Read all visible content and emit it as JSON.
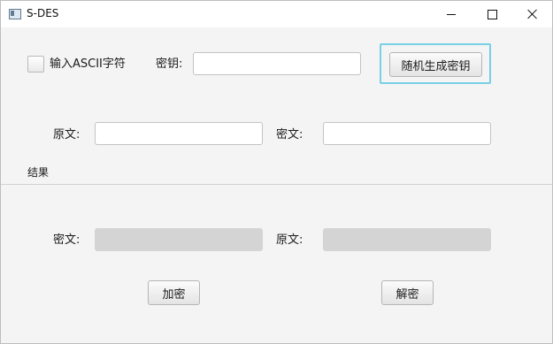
{
  "window": {
    "title": "S-DES"
  },
  "options": {
    "ascii_label": "输入ASCII字符"
  },
  "key": {
    "label": "密钥:",
    "value": "",
    "generate_label": "随机生成密钥"
  },
  "input": {
    "plaintext_label": "原文:",
    "plaintext_value": "",
    "ciphertext_label": "密文:",
    "ciphertext_value": ""
  },
  "result": {
    "section_label": "结果",
    "ciphertext_label": "密文:",
    "ciphertext_value": "",
    "plaintext_label": "原文:",
    "plaintext_value": ""
  },
  "actions": {
    "encrypt_label": "加密",
    "decrypt_label": "解密"
  },
  "colors": {
    "focus_ring": "#77d0e6",
    "disabled_field": "#d4d4d4",
    "background": "#f4f4f4"
  }
}
